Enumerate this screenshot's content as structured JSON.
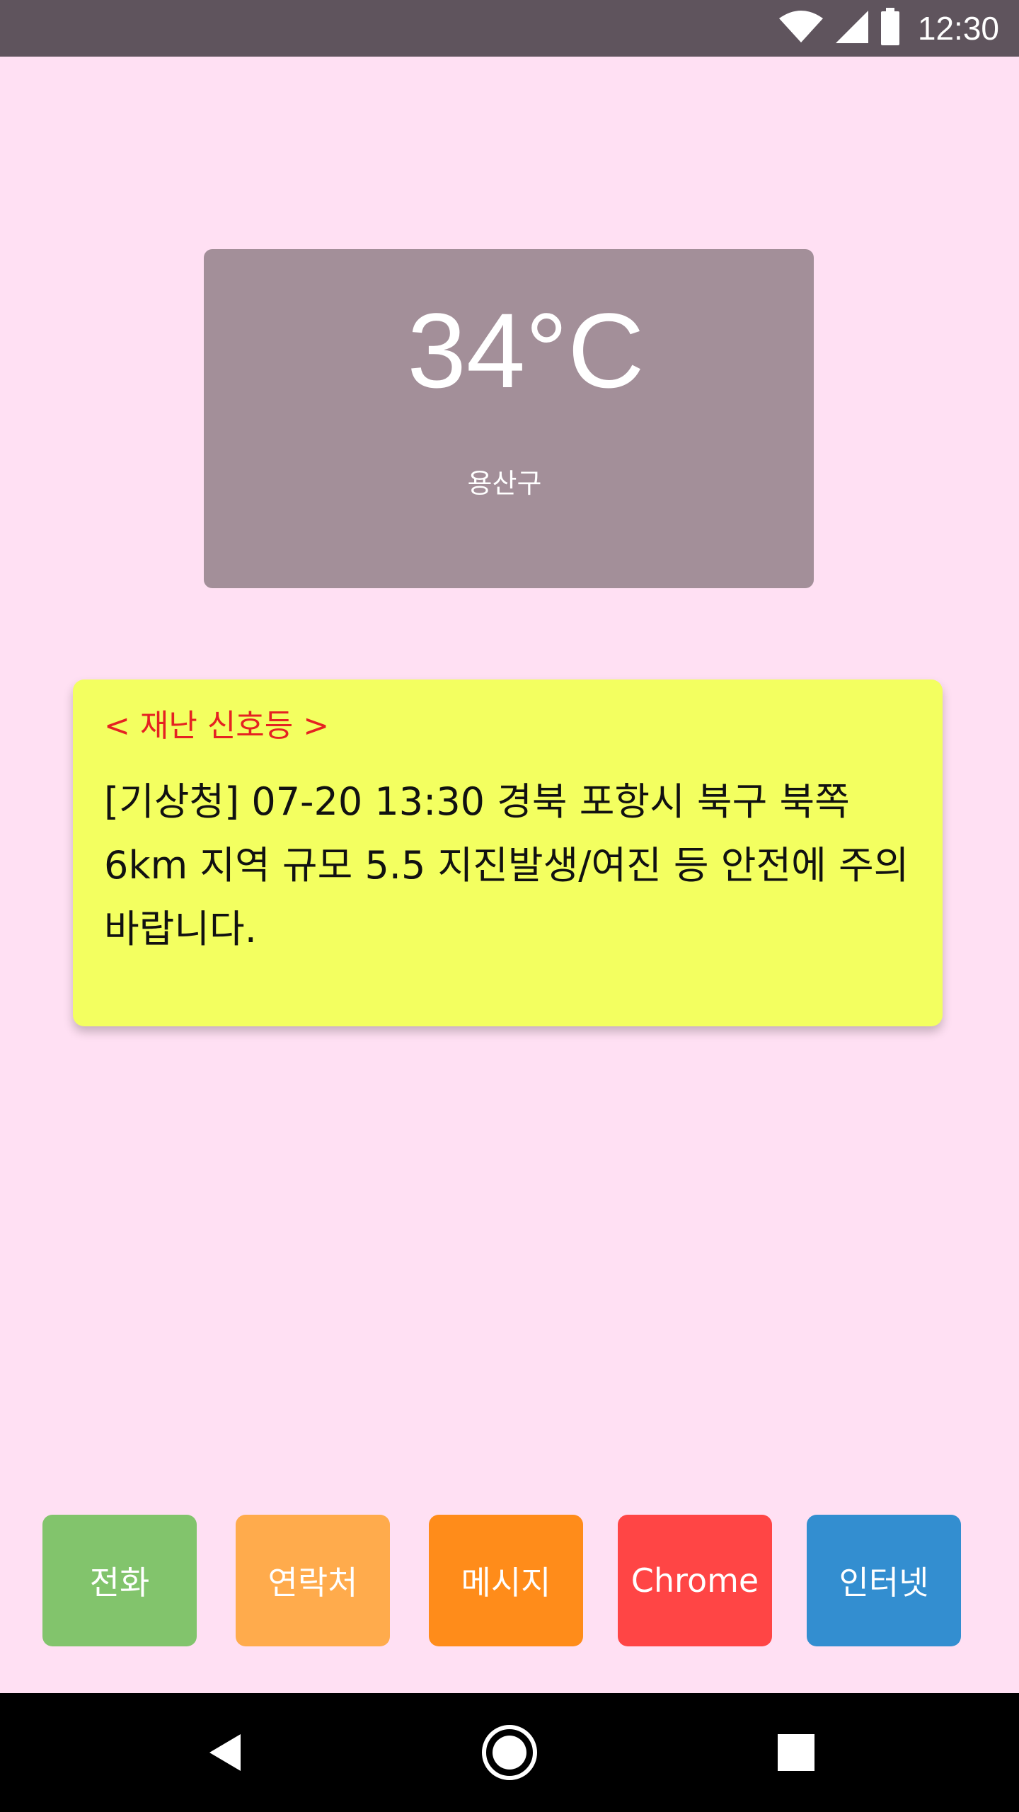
{
  "status_bar": {
    "time": "12:30",
    "icons": [
      "wifi-icon",
      "signal-icon",
      "battery-icon"
    ]
  },
  "weather": {
    "temperature": "34°C",
    "location": "용산구"
  },
  "alert": {
    "title": "< 재난 신호등 >",
    "message": "[기상청] 07-20 13:30 경북 포항시 북구 북쪽 6km 지역 규모 5.5 지진발생/여진 등 안전에 주의바랍니다."
  },
  "apps": {
    "phone": "전화",
    "contacts": "연락처",
    "message": "메시지",
    "chrome": "Chrome",
    "internet": "인터넷"
  },
  "nav": {
    "icons": [
      "back-icon",
      "home-icon",
      "recents-icon"
    ]
  },
  "colors": {
    "background": "#ffe0f3",
    "status_bar": "#5f545d",
    "weather_card": "#a38f99",
    "alert_card": "#f3ff60",
    "alert_title": "#e52222",
    "phone": "#82c46c",
    "contacts": "#ffab4c",
    "message": "#ff8c1a",
    "chrome": "#ff4545",
    "internet": "#338ed0"
  }
}
